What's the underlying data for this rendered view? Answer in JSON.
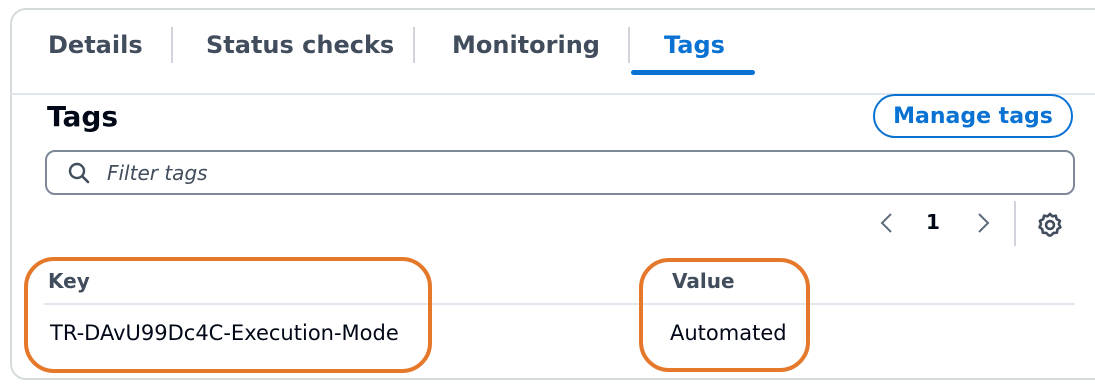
{
  "tabs": [
    {
      "label": "Details",
      "active": false
    },
    {
      "label": "Status checks",
      "active": false
    },
    {
      "label": "Monitoring",
      "active": false
    },
    {
      "label": "Tags",
      "active": true
    }
  ],
  "section": {
    "title": "Tags",
    "manage_button": "Manage tags"
  },
  "filter": {
    "placeholder": "Filter tags",
    "value": "",
    "icon": "search-icon"
  },
  "pagination": {
    "current_page": "1",
    "prev_icon": "chevron-left-icon",
    "next_icon": "chevron-right-icon",
    "settings_icon": "gear-icon"
  },
  "table": {
    "columns": [
      "Key",
      "Value"
    ],
    "rows": [
      [
        "TR-DAvU99Dc4C-Execution-Mode",
        "Automated"
      ]
    ]
  },
  "colors": {
    "accent": "#0972d3",
    "annotation": "#e5782a"
  }
}
